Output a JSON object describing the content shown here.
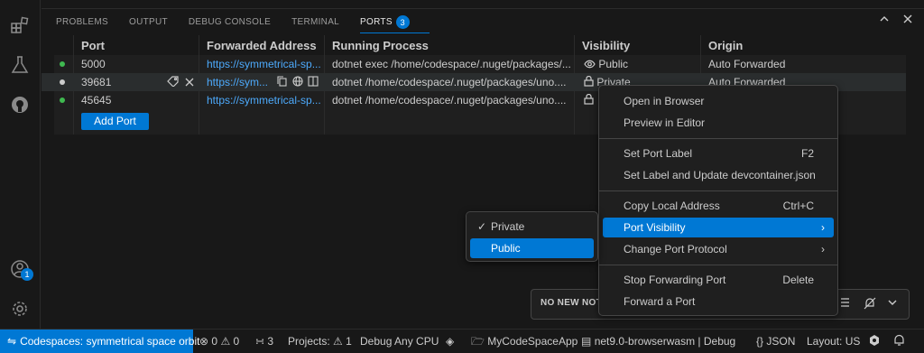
{
  "activity_bar": {
    "icons": [
      "extensions-icon",
      "testing-icon",
      "github-icon",
      "accounts-icon",
      "settings-gear-icon"
    ],
    "accounts_badge": "1"
  },
  "panel": {
    "tabs": [
      {
        "label": "PROBLEMS"
      },
      {
        "label": "OUTPUT"
      },
      {
        "label": "DEBUG CONSOLE"
      },
      {
        "label": "TERMINAL"
      },
      {
        "label": "PORTS",
        "count": "3",
        "active": true
      }
    ],
    "actions": [
      "maximize-panel-icon",
      "close-panel-icon"
    ]
  },
  "ports_table": {
    "headers": {
      "port": "Port",
      "address": "Forwarded Address",
      "process": "Running Process",
      "visibility": "Visibility",
      "origin": "Origin"
    },
    "rows": [
      {
        "port": "5000",
        "address": "https://symmetrical-sp...",
        "process": "dotnet exec /home/codespace/.nuget/packages/...",
        "visibility": "Public",
        "origin": "Auto Forwarded",
        "status": "green"
      },
      {
        "port": "39681",
        "address": "https://sym...",
        "process": "dotnet /home/codespace/.nuget/packages/uno....",
        "visibility": "Private",
        "origin": "Auto Forwarded",
        "status": "white"
      },
      {
        "port": "45645",
        "address": "https://symmetrical-sp...",
        "process": "dotnet /home/codespace/.nuget/packages/uno....",
        "visibility": "",
        "origin": "",
        "status": "green"
      }
    ],
    "add_port_label": "Add Port"
  },
  "context_menu": {
    "items": [
      {
        "label": "Open in Browser"
      },
      {
        "label": "Preview in Editor"
      },
      {
        "label": "Set Port Label",
        "shortcut": "F2"
      },
      {
        "label": "Set Label and Update devcontainer.json"
      },
      {
        "label": "Copy Local Address",
        "shortcut": "Ctrl+C"
      },
      {
        "label": "Port Visibility",
        "submenu": true,
        "selected": true
      },
      {
        "label": "Change Port Protocol",
        "submenu": true
      },
      {
        "label": "Stop Forwarding Port",
        "shortcut": "Delete"
      },
      {
        "label": "Forward a Port"
      }
    ]
  },
  "visibility_submenu": {
    "items": [
      {
        "label": "Private",
        "checked": true
      },
      {
        "label": "Public",
        "selected": true
      }
    ]
  },
  "notification": {
    "text": "NO NEW NOTI"
  },
  "status_bar": {
    "remote": "Codespaces: symmetrical space orbit",
    "errors": "0",
    "warnings": "0",
    "ports": "3",
    "projects": "Projects:",
    "projects_warning": "1",
    "config": "Debug Any CPU",
    "project": "MyCodeSpaceApp",
    "target": "net9.0-browserwasm | Debug",
    "language": "JSON",
    "layout": "Layout: US"
  },
  "colors": {
    "accent": "#0078d4",
    "link": "#4daafc",
    "status_green": "#3fb950"
  }
}
